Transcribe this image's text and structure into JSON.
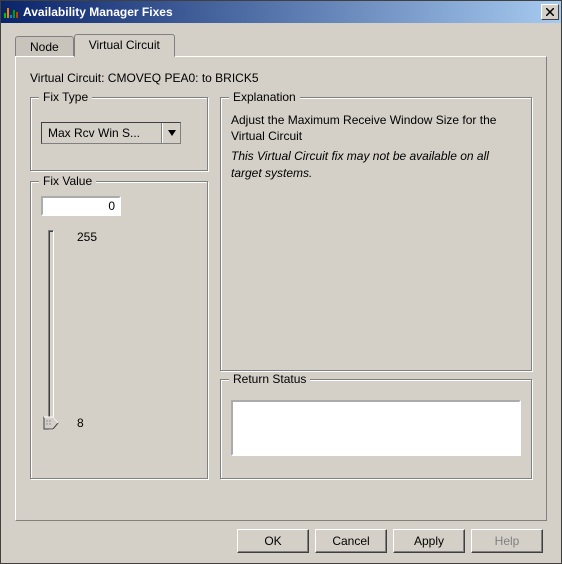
{
  "window": {
    "title": "Availability Manager Fixes"
  },
  "tabs": {
    "node": "Node",
    "virtual_circuit": "Virtual Circuit"
  },
  "vc_line": "Virtual Circuit: CMOVEQ PEA0: to BRICK5",
  "fix_type": {
    "legend": "Fix Type",
    "selected": "Max Rcv Win S..."
  },
  "fix_value": {
    "legend": "Fix Value",
    "value": "0",
    "max_label": "255",
    "min_label": "8"
  },
  "explanation": {
    "legend": "Explanation",
    "line1": "Adjust the Maximum Receive Window Size for the Virtual Circuit",
    "line2": "This Virtual Circuit fix may not be available on all target systems."
  },
  "return_status": {
    "legend": "Return Status"
  },
  "buttons": {
    "ok": "OK",
    "cancel": "Cancel",
    "apply": "Apply",
    "help": "Help"
  }
}
